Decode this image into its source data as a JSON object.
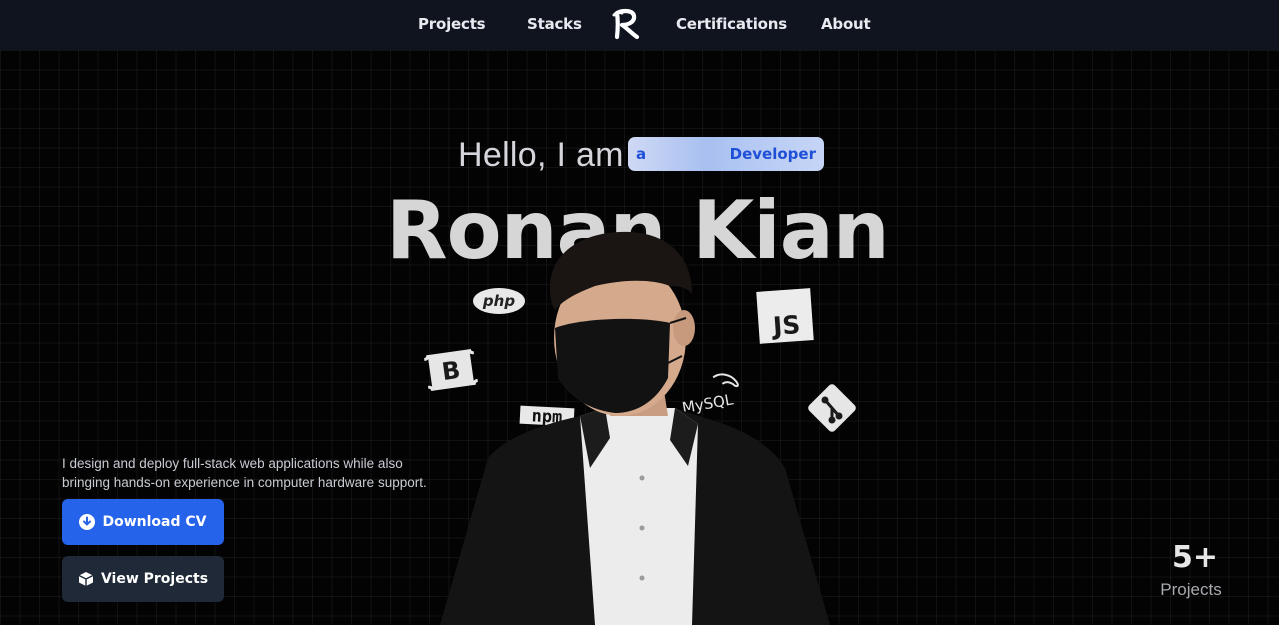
{
  "nav": {
    "items": [
      {
        "label": "Projects"
      },
      {
        "label": "Stacks"
      },
      {
        "label": "Certifications"
      },
      {
        "label": "About"
      }
    ],
    "logo_icon": "letter-r-logo"
  },
  "hero": {
    "greeting": "Hello, I am",
    "role_prefix": "a",
    "role_word": "Developer",
    "name": "Ronan Kian",
    "description": "I design and deploy full-stack web applications while also bringing hands-on experience in computer hardware support."
  },
  "stack_icons": [
    {
      "name": "php-icon",
      "label": "php"
    },
    {
      "name": "bootstrap-icon",
      "label": "B"
    },
    {
      "name": "npm-icon",
      "label": "npm"
    },
    {
      "name": "javascript-icon",
      "label": "JS"
    },
    {
      "name": "mysql-icon",
      "label": "MySQL"
    },
    {
      "name": "git-icon"
    }
  ],
  "buttons": {
    "download_cv": "Download CV",
    "view_projects": "View Projects"
  },
  "stats": {
    "count": "5+",
    "label": "Projects"
  },
  "colors": {
    "accent_blue": "#2563eb",
    "nav_bg": "#10141f",
    "secondary_button": "#1f2937",
    "role_text": "#1f4fd6"
  }
}
